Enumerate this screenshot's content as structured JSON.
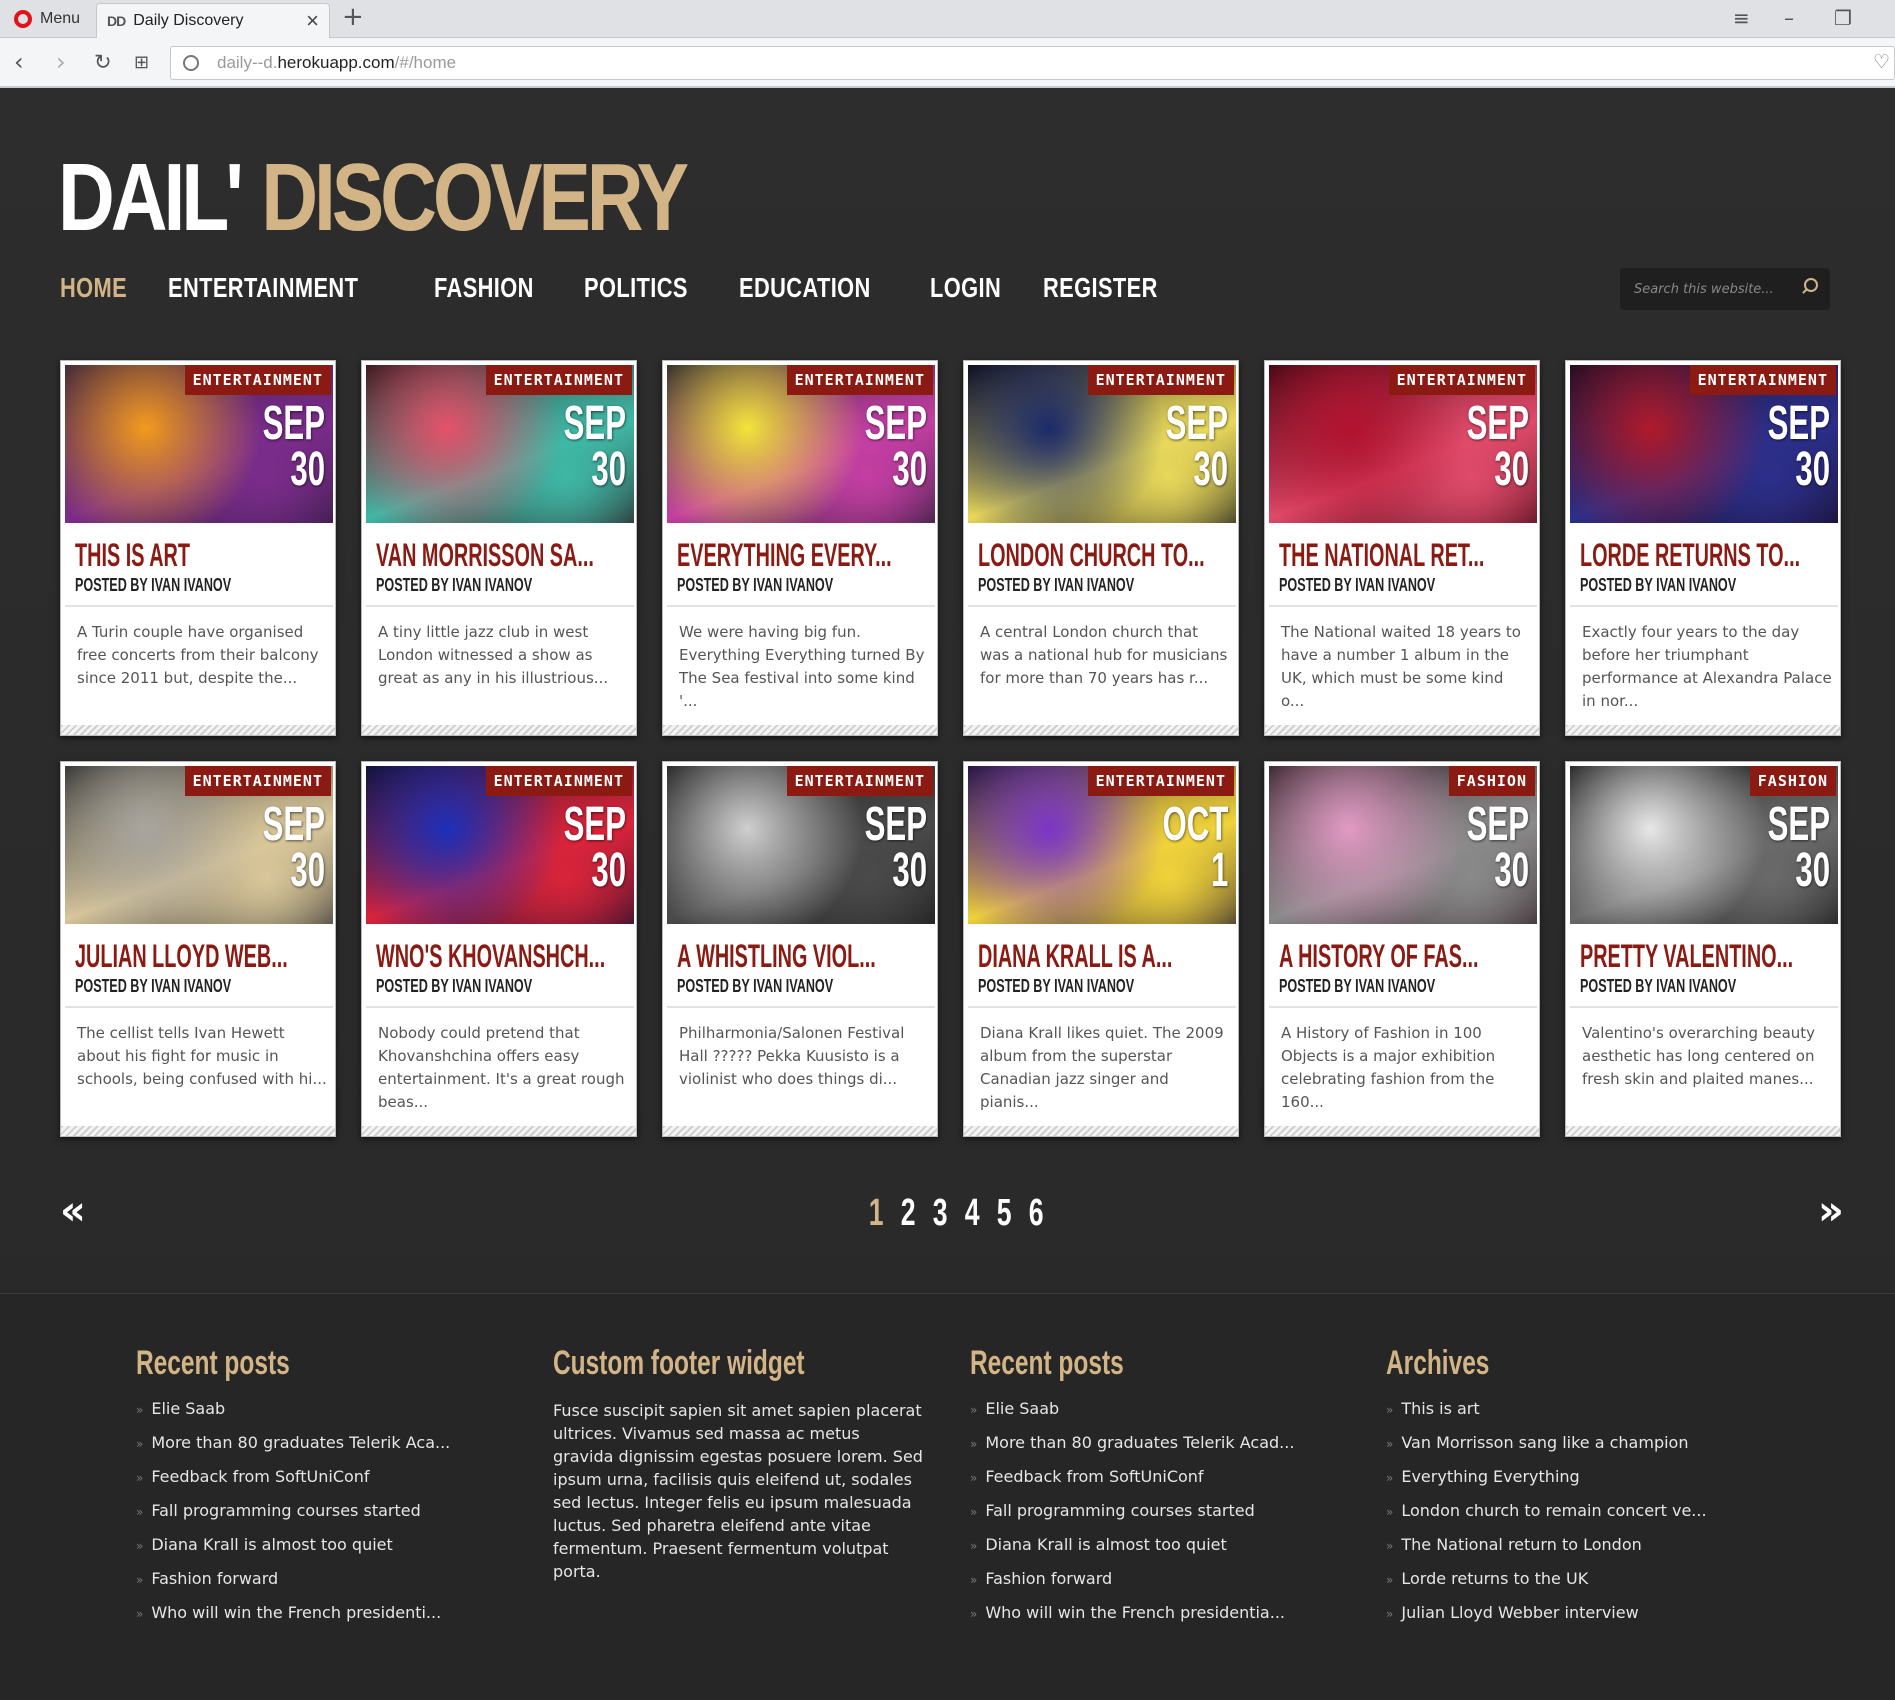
{
  "browser": {
    "menu_label": "Menu",
    "tab_favicon": "DD",
    "tab_title": "Daily Discovery",
    "url_prefix": "daily--d.",
    "url_domain": "herokuapp.com",
    "url_path": "/#/home"
  },
  "site": {
    "logo_part1": "DAIL'",
    "logo_part2": "DISCOVERY",
    "nav": [
      "HOME",
      "ENTERTAINMENT",
      "FASHION",
      "POLITICS",
      "EDUCATION",
      "LOGIN",
      "REGISTER"
    ],
    "active_nav": "HOME",
    "search_placeholder": "Search this website..."
  },
  "posts": [
    {
      "category": "ENTERTAINMENT",
      "month": "SEP",
      "day": "30",
      "title": "THIS IS ART",
      "author": "POSTED BY IVAN IVANOV",
      "excerpt": "A Turin couple have organised free concerts from their balcony since 2011 but, despite the...",
      "img_colors": [
        "#f29b1d",
        "#7b2c8b",
        "#2b1a3a"
      ]
    },
    {
      "category": "ENTERTAINMENT",
      "month": "SEP",
      "day": "30",
      "title": "VAN MORRISSON SA...",
      "author": "POSTED BY IVAN IVANOV",
      "excerpt": "A tiny little jazz club in west London witnessed a show as great as any in his illustrious...",
      "img_colors": [
        "#e6516a",
        "#3fb8a6",
        "#2a0f14"
      ]
    },
    {
      "category": "ENTERTAINMENT",
      "month": "SEP",
      "day": "30",
      "title": "EVERYTHING EVERY...",
      "author": "POSTED BY IVAN IVANOV",
      "excerpt": "We were having big fun. Everything Everything turned By The Sea festival into some kind '...",
      "img_colors": [
        "#f3e43a",
        "#c43ea3",
        "#1a1a2a"
      ]
    },
    {
      "category": "ENTERTAINMENT",
      "month": "SEP",
      "day": "30",
      "title": "LONDON CHURCH TO...",
      "author": "POSTED BY IVAN IVANOV",
      "excerpt": "A central London church that was a national hub for musicians for more than 70 years has r...",
      "img_colors": [
        "#1b2a6b",
        "#e8d85a",
        "#0b0b1a"
      ]
    },
    {
      "category": "ENTERTAINMENT",
      "month": "SEP",
      "day": "30",
      "title": "THE NATIONAL RET...",
      "author": "POSTED BY IVAN IVANOV",
      "excerpt": "The National waited 18 years to have a number 1 album in the UK, which must be some kind o...",
      "img_colors": [
        "#b3122e",
        "#e04a6a",
        "#3a0610"
      ]
    },
    {
      "category": "ENTERTAINMENT",
      "month": "SEP",
      "day": "30",
      "title": "LORDE RETURNS TO...",
      "author": "POSTED BY IVAN IVANOV",
      "excerpt": "Exactly four years to the day before her triumphant performance at Alexandra Palace in nor...",
      "img_colors": [
        "#b01a2a",
        "#2c2f8a",
        "#140a1e"
      ]
    },
    {
      "category": "ENTERTAINMENT",
      "month": "SEP",
      "day": "30",
      "title": "JULIAN LLOYD WEB...",
      "author": "POSTED BY IVAN IVANOV",
      "excerpt": "The cellist tells Ivan Hewett about his fight for music in schools, being confused with hi...",
      "img_colors": [
        "#a9a59e",
        "#d9c79a",
        "#2a2a2a"
      ]
    },
    {
      "category": "ENTERTAINMENT",
      "month": "SEP",
      "day": "30",
      "title": "WNO'S KHOVANSHCH...",
      "author": "POSTED BY IVAN IVANOV",
      "excerpt": "Nobody could pretend that Khovanshchina offers easy entertainment. It's a great rough beas...",
      "img_colors": [
        "#1d2fb8",
        "#d9243a",
        "#0e0e2a"
      ]
    },
    {
      "category": "ENTERTAINMENT",
      "month": "SEP",
      "day": "30",
      "title": "A WHISTLING VIOL...",
      "author": "POSTED BY IVAN IVANOV",
      "excerpt": "Philharmonia/Salonen Festival Hall ????? Pekka Kuusisto is a violinist who does things di...",
      "img_colors": [
        "#cfcfcf",
        "#4a4a4a",
        "#151515"
      ]
    },
    {
      "category": "ENTERTAINMENT",
      "month": "OCT",
      "day": "1",
      "title": "DIANA KRALL IS A...",
      "author": "POSTED BY IVAN IVANOV",
      "excerpt": "Diana Krall likes quiet. The 2009 album from the superstar Canadian jazz singer and pianis...",
      "img_colors": [
        "#7b35c8",
        "#f0d23a",
        "#1a1030"
      ]
    },
    {
      "category": "FASHION",
      "month": "SEP",
      "day": "30",
      "title": "A HISTORY OF FAS...",
      "author": "POSTED BY IVAN IVANOV",
      "excerpt": "A History of Fashion in 100 Objects is a major exhibition celebrating fashion from the 160...",
      "img_colors": [
        "#e29ac4",
        "#8a8a8a",
        "#2a1a20"
      ]
    },
    {
      "category": "FASHION",
      "month": "SEP",
      "day": "30",
      "title": "PRETTY VALENTINO...",
      "author": "POSTED BY IVAN IVANOV",
      "excerpt": "Valentino's overarching beauty aesthetic has long centered on fresh skin and plaited manes...",
      "img_colors": [
        "#e8e8e8",
        "#6a6a6a",
        "#111111"
      ]
    }
  ],
  "pagination": {
    "prev": "«",
    "next": "»",
    "pages": [
      "1",
      "2",
      "3",
      "4",
      "5",
      "6"
    ],
    "active": "1"
  },
  "footer": {
    "col1": {
      "title": "Recent posts",
      "items": [
        "Elie Saab",
        "More than 80 graduates Telerik Aca...",
        "Feedback from SoftUniConf",
        "Fall programming courses started",
        "Diana Krall is almost too quiet",
        "Fashion forward",
        "Who will win the French presidenti..."
      ]
    },
    "col2": {
      "title": "Custom footer widget",
      "text": "Fusce suscipit sapien sit amet sapien placerat ultrices. Vivamus sed massa ac metus gravida dignissim egestas posuere lorem. Sed ipsum urna, facilisis quis eleifend ut, sodales sed lectus. Integer felis eu ipsum malesuada luctus. Sed pharetra eleifend ante vitae fermentum. Praesent fermentum volutpat porta."
    },
    "col3": {
      "title": "Recent posts",
      "items": [
        "Elie Saab",
        "More than 80 graduates Telerik Acad...",
        "Feedback from SoftUniConf",
        "Fall programming courses started",
        "Diana Krall is almost too quiet",
        "Fashion forward",
        "Who will win the French presidentia..."
      ]
    },
    "col4": {
      "title": "Archives",
      "items": [
        "This is art",
        "Van Morrisson sang like a champion",
        "Everything Everything",
        "London church to remain concert ve...",
        "The National return to London",
        "Lorde returns to the UK",
        "Julian Lloyd Webber interview"
      ]
    }
  }
}
